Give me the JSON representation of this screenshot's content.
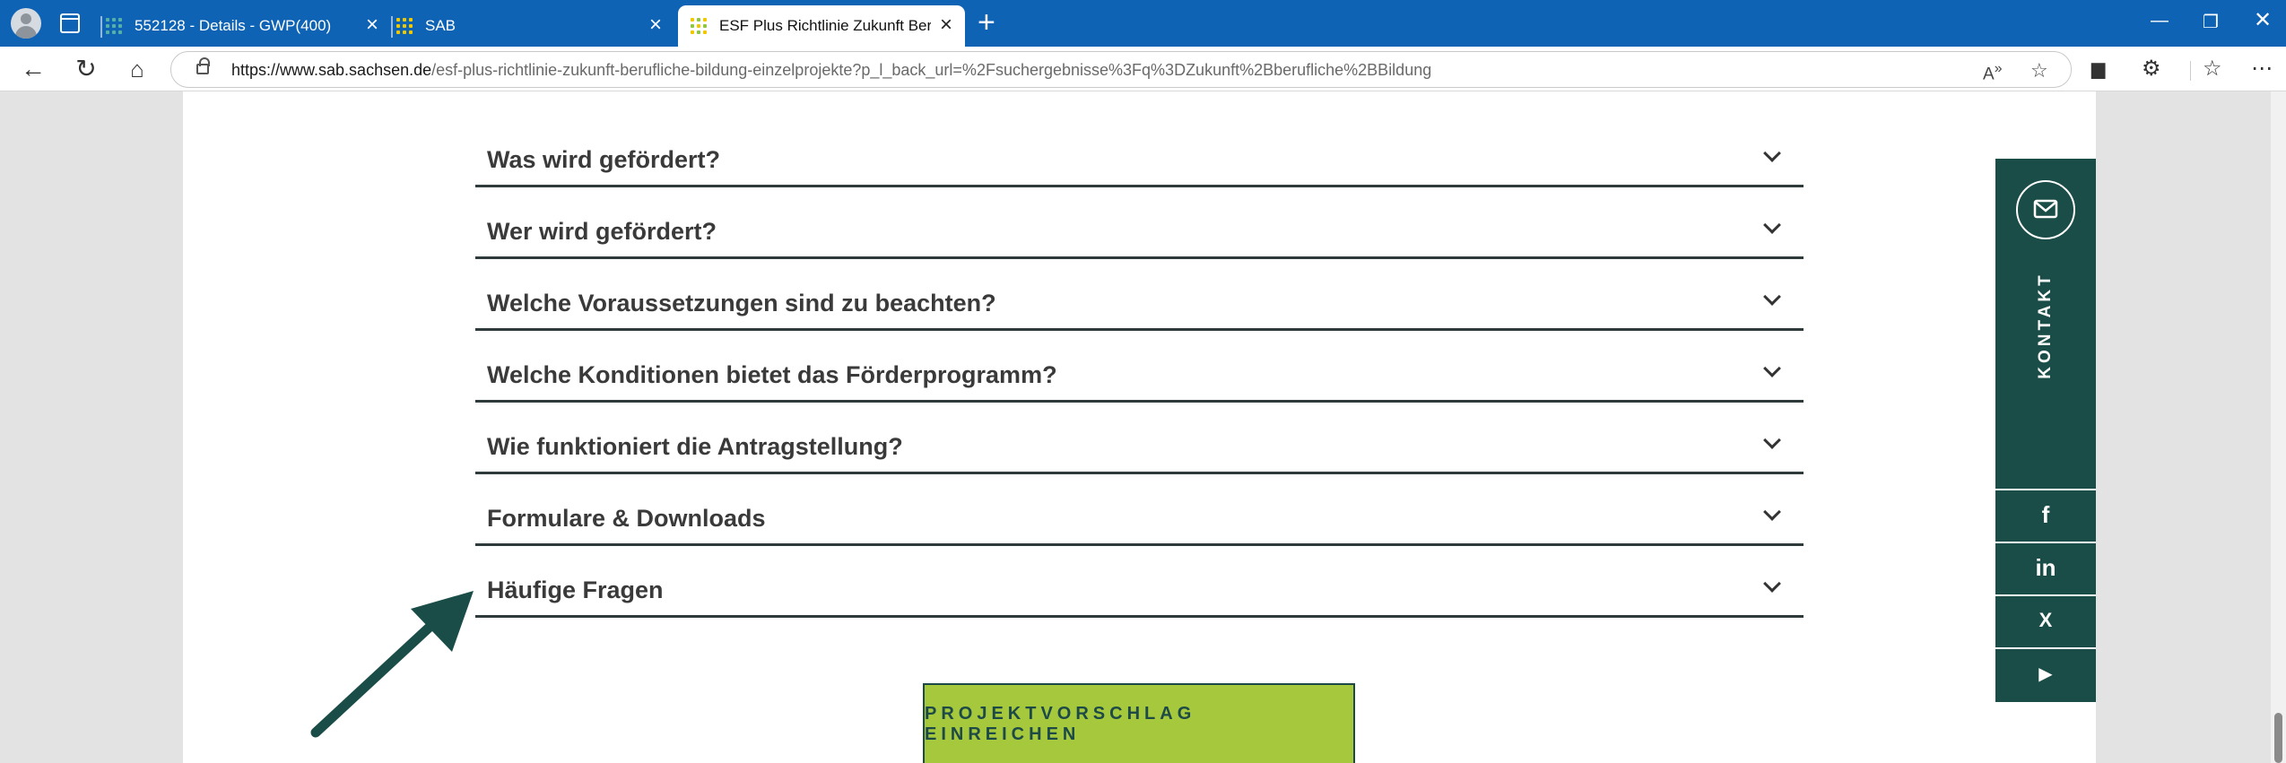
{
  "browser": {
    "tabs": [
      {
        "title": "552128 - Details - GWP(400)",
        "favicon_color": "#55b0a8"
      },
      {
        "title": "SAB",
        "favicon_color": "#f0c800"
      },
      {
        "title": "ESF Plus Richtlinie Zukunft Berufli",
        "favicon_color": "#f0c800",
        "active": true
      }
    ],
    "new_tab_icon": "plus-icon",
    "window_controls": [
      "minimize-icon",
      "restore-icon",
      "close-icon"
    ],
    "url_host": "https://www.sab.sachsen.de",
    "url_path": "/esf-plus-richtlinie-zukunft-berufliche-bildung-einzelprojekte?p_l_back_url=%2Fsuchergebnisse%3Fq%3DZukunft%2Bberufliche%2BBildung"
  },
  "accordion": {
    "items": [
      {
        "label": "Was wird gefördert?"
      },
      {
        "label": "Wer wird gefördert?"
      },
      {
        "label": "Welche Voraussetzungen sind zu beachten?"
      },
      {
        "label": "Welche Konditionen bietet das Förderprogramm?"
      },
      {
        "label": "Wie funktioniert die Antragstellung?"
      },
      {
        "label": "Formulare & Downloads"
      },
      {
        "label": "Häufige Fragen"
      }
    ]
  },
  "cta": {
    "label": "PROJEKTVORSCHLAG EINREICHEN"
  },
  "sidebar": {
    "kontakt_label": "KONTAKT",
    "social": [
      {
        "icon": "facebook-icon",
        "label": "f"
      },
      {
        "icon": "linkedin-icon",
        "label": "in"
      },
      {
        "icon": "xing-icon",
        "label": "X"
      },
      {
        "icon": "youtube-icon",
        "label": "▶"
      }
    ]
  },
  "colors": {
    "tabbar": "#0f63b5",
    "sidebar": "#1a4d48",
    "cta_bg": "#a5c83d",
    "annotation_arrow": "#1a4d48"
  }
}
